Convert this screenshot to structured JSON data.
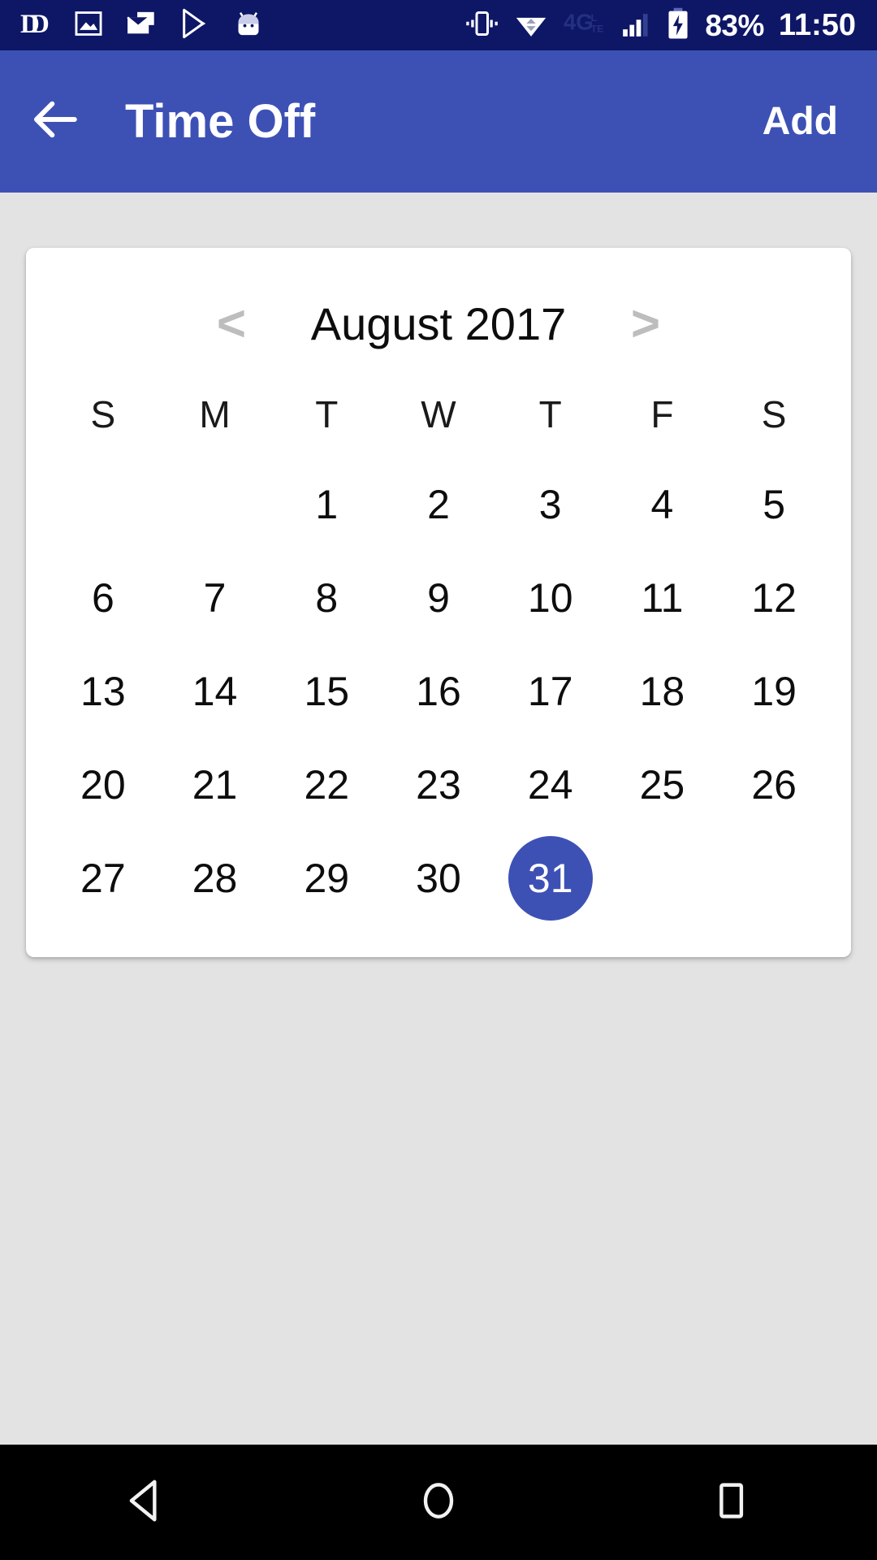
{
  "status_bar": {
    "background": "#0e1666",
    "left_icons": [
      {
        "name": "dd-app-icon",
        "label": "DD"
      },
      {
        "name": "photos-icon",
        "label": "Photos"
      },
      {
        "name": "email-icon",
        "label": "Email"
      },
      {
        "name": "play-store-icon",
        "label": "Play Store"
      },
      {
        "name": "android-system-icon",
        "label": "Android"
      }
    ],
    "right_icons": [
      {
        "name": "vibrate-mode-icon",
        "label": "Vibrate"
      },
      {
        "name": "wifi-icon",
        "label": "Wi-Fi"
      },
      {
        "name": "network-4glte-icon",
        "label": "4G LTE"
      },
      {
        "name": "signal-bars-icon",
        "label": "Signal"
      },
      {
        "name": "battery-charging-icon",
        "label": "Charging"
      }
    ],
    "battery_percent": "83%",
    "clock": "11:50"
  },
  "app_bar": {
    "background": "#3d51b5",
    "back_label": "Back",
    "title": "Time Off",
    "action_label": "Add"
  },
  "calendar": {
    "prev_arrow": "<",
    "next_arrow": ">",
    "month_label": "August 2017",
    "weekday_headers": [
      "S",
      "M",
      "T",
      "W",
      "T",
      "F",
      "S"
    ],
    "selected_day": "31",
    "selected_color": "#3d51b5",
    "weeks": [
      [
        "",
        "",
        "1",
        "2",
        "3",
        "4",
        "5"
      ],
      [
        "6",
        "7",
        "8",
        "9",
        "10",
        "11",
        "12"
      ],
      [
        "13",
        "14",
        "15",
        "16",
        "17",
        "18",
        "19"
      ],
      [
        "20",
        "21",
        "22",
        "23",
        "24",
        "25",
        "26"
      ],
      [
        "27",
        "28",
        "29",
        "30",
        "31",
        "",
        ""
      ]
    ]
  },
  "nav_bar": {
    "background": "#000000",
    "buttons": [
      {
        "name": "nav-back-button",
        "label": "Back"
      },
      {
        "name": "nav-home-button",
        "label": "Home"
      },
      {
        "name": "nav-recents-button",
        "label": "Recents"
      }
    ]
  }
}
